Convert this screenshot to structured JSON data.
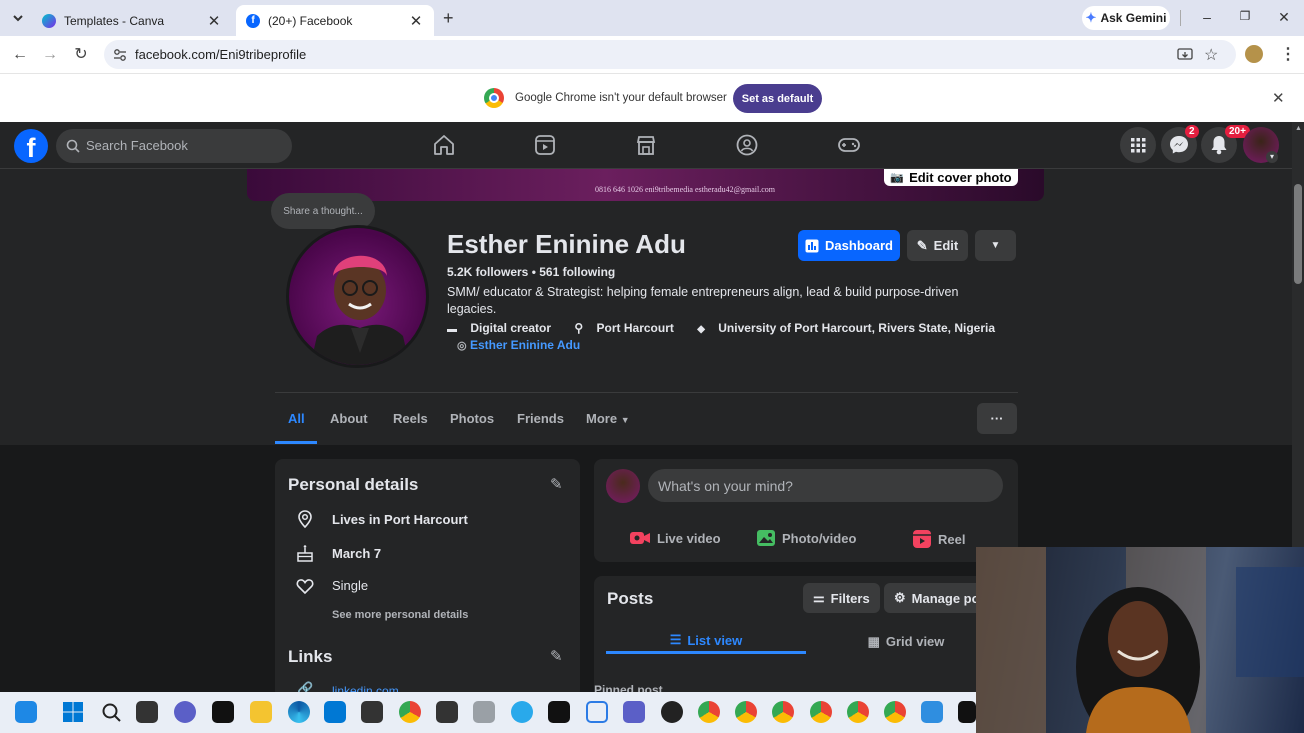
{
  "browser": {
    "tabs": [
      {
        "title": "Templates - Canva"
      },
      {
        "title": "(20+) Facebook"
      }
    ],
    "url": "facebook.com/Eni9tribeprofile",
    "gemini_label": "Ask Gemini",
    "infobar": {
      "message": "Google Chrome isn't your default browser",
      "button": "Set as default"
    }
  },
  "fb_header": {
    "search_placeholder": "Search Facebook",
    "messenger_badge": "2",
    "notifications_badge": "20+"
  },
  "profile": {
    "cover_text": "0816 646 1026    eni9tribemedia         estheradu42@gmail.com",
    "edit_cover_label": "Edit cover photo",
    "share_thought": "Share a thought...",
    "name": "Esther Eninine Adu",
    "followers_line": "5.2K followers • 561 following",
    "bio": "SMM/ educator & Strategist: helping female entrepreneurs align, lead & build purpose-driven legacies.",
    "category": "Digital creator",
    "location": "Port Harcourt",
    "education": "University of Port Harcourt, Rivers State, Nigeria",
    "instagram": "Esther Eninine Adu",
    "buttons": {
      "dashboard": "Dashboard",
      "edit": "Edit"
    },
    "tabs": [
      "All",
      "About",
      "Reels",
      "Photos",
      "Friends",
      "More"
    ],
    "more_dots": "···"
  },
  "personal_details": {
    "title": "Personal details",
    "lives_in": "Lives in Port Harcourt",
    "birthday": "March 7",
    "relationship": "Single",
    "see_more": "See more personal details",
    "links_title": "Links",
    "link1": "linkedin.com"
  },
  "composer": {
    "placeholder": "What's on your mind?",
    "live": "Live video",
    "photo": "Photo/video",
    "reel": "Reel"
  },
  "posts": {
    "title": "Posts",
    "filters": "Filters",
    "manage": "Manage po",
    "list_view": "List view",
    "grid_view": "Grid view",
    "pinned": "Pinned post"
  },
  "colors": {
    "fb_blue": "#0866ff",
    "link_blue": "#4599ff",
    "badge_red": "#e41e3f",
    "card_bg": "#242526",
    "page_bg": "#18191a"
  }
}
